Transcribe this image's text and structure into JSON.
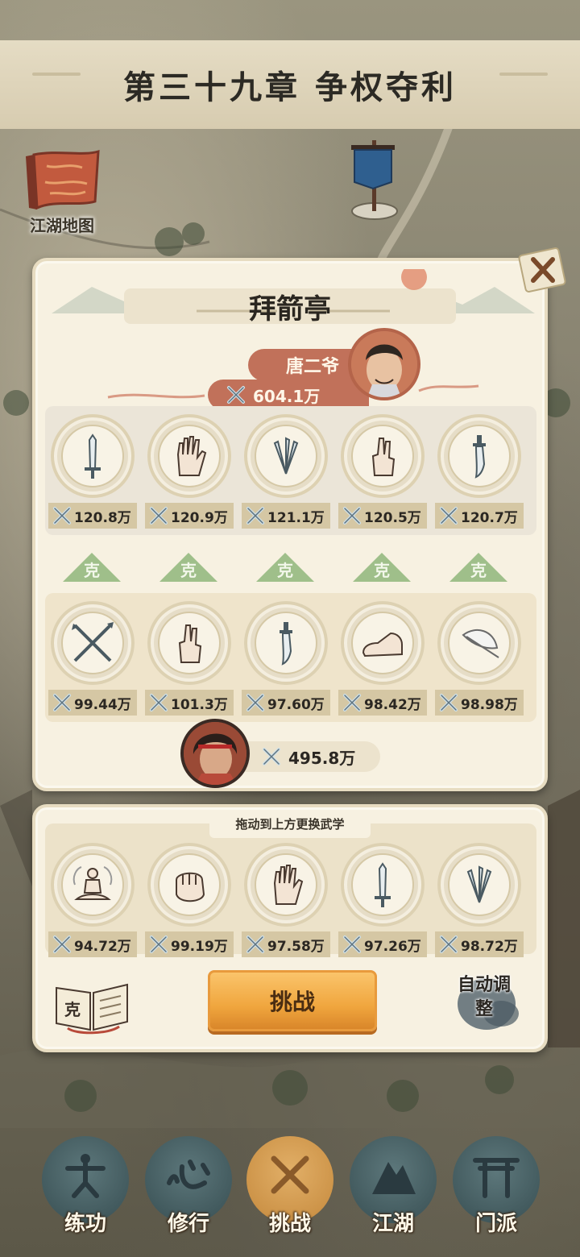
{
  "chapter": {
    "title": "第三十九章 争权夺利"
  },
  "map_button": {
    "label": "江湖地图"
  },
  "modal": {
    "title": "拜箭亭",
    "enemy": {
      "name": "唐二爷",
      "power": "604.1万"
    },
    "enemy_skills": [
      {
        "icon": "sword-icon",
        "power": "120.8万"
      },
      {
        "icon": "palm-icon",
        "power": "120.9万"
      },
      {
        "icon": "throwing-knives-icon",
        "power": "121.1万"
      },
      {
        "icon": "finger-icon",
        "power": "120.5万"
      },
      {
        "icon": "saber-icon",
        "power": "120.7万"
      }
    ],
    "counter_label": "克",
    "player_skills": [
      {
        "icon": "crossed-spears-icon",
        "power": "99.44万"
      },
      {
        "icon": "finger-icon",
        "power": "101.3万"
      },
      {
        "icon": "saber-icon",
        "power": "97.60万"
      },
      {
        "icon": "shoe-icon",
        "power": "98.42万"
      },
      {
        "icon": "feather-icon",
        "power": "98.98万"
      }
    ],
    "player": {
      "power": "495.8万"
    }
  },
  "loadout": {
    "hint": "拖动到上方更换武学",
    "skills": [
      {
        "icon": "meditation-icon",
        "power": "94.72万"
      },
      {
        "icon": "fist-icon",
        "power": "99.19万"
      },
      {
        "icon": "palm-icon",
        "power": "97.58万"
      },
      {
        "icon": "sword-icon",
        "power": "97.26万"
      },
      {
        "icon": "throwing-knives-icon",
        "power": "98.72万"
      }
    ],
    "book_label": "克",
    "challenge_label": "挑战",
    "auto_label": "自动调整"
  },
  "nav": {
    "items": [
      {
        "label": "练功",
        "icon": "training-icon"
      },
      {
        "label": "修行",
        "icon": "heart-icon"
      },
      {
        "label": "挑战",
        "icon": "crossed-swords-icon"
      },
      {
        "label": "江湖",
        "icon": "mountain-icon"
      },
      {
        "label": "门派",
        "icon": "gate-icon"
      }
    ]
  },
  "colors": {
    "panel": "#f7f1e1",
    "name_plate": "#c1715a",
    "counter": "#9fbf8a",
    "challenge": "#f0a63e"
  }
}
